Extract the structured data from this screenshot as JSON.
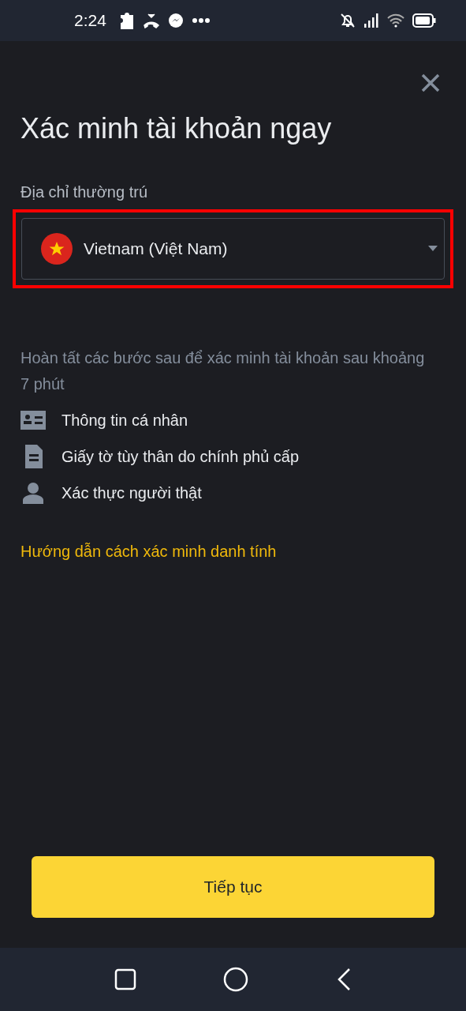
{
  "status_bar": {
    "time": "2:24"
  },
  "title": "Xác minh tài khoản ngay",
  "residence": {
    "label": "Địa chỉ thường trú",
    "value": "Vietnam (Việt Nam)",
    "highlighted": true
  },
  "description": "Hoàn tất các bước sau để xác minh tài khoản sau khoảng 7 phút",
  "steps": [
    {
      "kind": "id-card",
      "label": "Thông tin cá nhân"
    },
    {
      "kind": "document",
      "label": "Giấy tờ tùy thân do chính phủ cấp"
    },
    {
      "kind": "person",
      "label": "Xác thực người thật"
    }
  ],
  "guide_link": "Hướng dẫn cách xác minh danh tính",
  "continue_button": "Tiếp tục"
}
